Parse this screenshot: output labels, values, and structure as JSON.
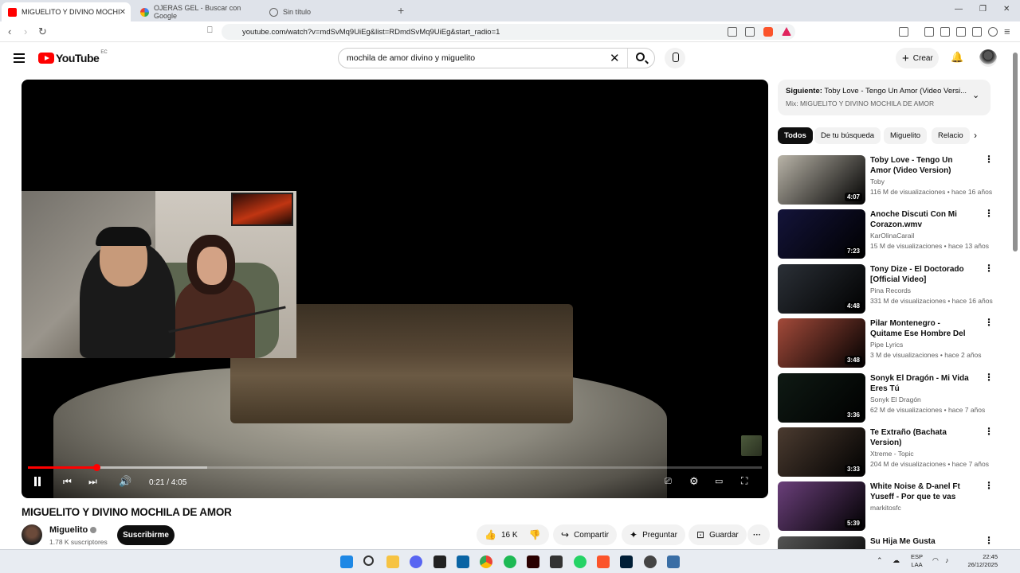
{
  "browser": {
    "tabs": [
      {
        "title": "MIGUELITO Y DIVINO MOCHI",
        "active": true
      },
      {
        "title": "OJERAS GEL - Buscar con Google",
        "active": false
      },
      {
        "title": "Sin título",
        "active": false
      }
    ],
    "url": "youtube.com/watch?v=mdSvMq9UiEg&list=RDmdSvMq9UiEg&start_radio=1"
  },
  "header": {
    "logo_text": "YouTube",
    "country_code": "EC",
    "search_query": "mochila de amor divino y miguelito",
    "create_label": "Crear"
  },
  "player": {
    "current_time": "0:21",
    "duration": "4:05",
    "time_display": "0:21 / 4:05",
    "progress_fraction": 0.093
  },
  "video": {
    "title": "MIGUELITO Y DIVINO MOCHILA DE AMOR",
    "channel": "Miguelito",
    "subscribers": "1.78 K suscriptores",
    "subscribe_label": "Suscribirme",
    "likes": "16 K",
    "share_label": "Compartir",
    "ask_label": "Preguntar",
    "save_label": "Guardar"
  },
  "queue": {
    "next_prefix": "Siguiente:",
    "next_title": "Toby Love - Tengo Un Amor (Video Versi...",
    "mix_label": "Mix: MIGUELITO Y DIVINO MOCHILA DE AMOR"
  },
  "chips": [
    "Todos",
    "De tu búsqueda",
    "Miguelito",
    "Relacio"
  ],
  "recommendations": [
    {
      "title": "Toby Love - Tengo Un Amor (Video Version)",
      "channel": "Toby",
      "meta": "116 M de visualizaciones • hace 16 años",
      "duration": "4:07",
      "color": "#b9b4a8"
    },
    {
      "title": "Anoche Discuti Con Mi Corazon.wmv",
      "channel": "KarOlinaCarail",
      "meta": "15 M de visualizaciones • hace 13 años",
      "duration": "7:23",
      "color": "#14143a"
    },
    {
      "title": "Tony Dize - El Doctorado [Official Video]",
      "channel": "Pina Records",
      "meta": "331 M de visualizaciones • hace 16 años",
      "duration": "4:48",
      "color": "#2b3037"
    },
    {
      "title": "Pilar Montenegro - Quitame Ese Hombre Del Corazón (Letra)",
      "channel": "Pipe Lyrics",
      "meta": "3 M de visualizaciones • hace 2 años",
      "duration": "3:48",
      "color": "#a34a3a"
    },
    {
      "title": "Sonyk El Dragón - Mi Vida Eres Tú",
      "channel": "Sonyk El Dragón",
      "meta": "62 M de visualizaciones • hace 7 años",
      "duration": "3:36",
      "color": "#0f1a14"
    },
    {
      "title": "Te Extraño (Bachata Version)",
      "channel": "Xtreme - Topic",
      "meta": "204 M de visualizaciones • hace 7 años",
      "duration": "3:33",
      "color": "#4b3b30"
    },
    {
      "title": "White Noise & D-anel Ft Yuseff - Por que te vas (Official Remix)...",
      "channel": "markitosfc",
      "meta": "",
      "duration": "5:39",
      "color": "#6a3f7a"
    },
    {
      "title": "Su Hija Me Gusta",
      "channel": "",
      "meta": "",
      "duration": "",
      "color": "#555555"
    }
  ],
  "taskbar": {
    "lang_top": "ESP",
    "lang_bottom": "LAA",
    "time": "22:45",
    "date": "26/12/2025"
  }
}
